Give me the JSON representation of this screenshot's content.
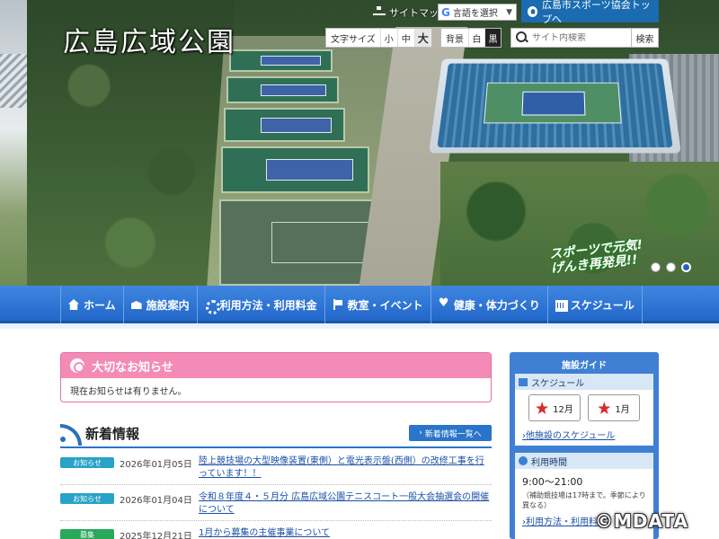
{
  "header": {
    "site_title": "広島広域公園",
    "sitemap_label": "サイトマップ",
    "translate_label": "言語を選択",
    "sports_link": "広島市スポーツ協会トップへ",
    "fontsize": {
      "label": "文字サイズ",
      "small": "小",
      "medium": "中",
      "large": "大"
    },
    "bg": {
      "label": "背景",
      "white": "白",
      "black": "黒"
    },
    "search": {
      "placeholder": "サイト内検索",
      "button": "検索"
    },
    "slogan_line1": "スポーツで元気!",
    "slogan_line2": "げんき再発見!!"
  },
  "nav": {
    "items": [
      {
        "label": "ホーム",
        "icon": "home-icon"
      },
      {
        "label": "施設案内",
        "icon": "facility-icon"
      },
      {
        "label": "利用方法・利用料金",
        "icon": "gear-icon"
      },
      {
        "label": "教室・イベント",
        "icon": "flag-icon"
      },
      {
        "label": "健康・体力づくり",
        "icon": "heart-icon"
      },
      {
        "label": "スケジュール",
        "icon": "calendar-icon"
      }
    ]
  },
  "alert": {
    "title": "大切なお知らせ",
    "body": "現在お知らせは有りません。"
  },
  "news": {
    "title": "新着情報",
    "more": "新着情報一覧へ",
    "items": [
      {
        "tag": "お知らせ",
        "date": "2026年01月05日",
        "text": "陸上競技場の大型映像装置(東側）と電光表示盤(西側）の改修工事を行っています！！"
      },
      {
        "tag": "お知らせ",
        "date": "2026年01月04日",
        "text": "令和８年度４・５月分 広島広域公園テニスコート一般大会抽選会の開催について"
      },
      {
        "tag": "募集",
        "date": "2025年12月21日",
        "text": "1月から募集の主催事業について"
      }
    ]
  },
  "sidebar": {
    "title": "施設ガイド",
    "schedule": {
      "heading": "スケジュール",
      "btn1": "12月",
      "btn2": "1月",
      "link": "他施設のスケジュール"
    },
    "hours": {
      "heading": "利用時間",
      "time": "9:00～21:00",
      "note": "（補助競技場は17時まで。季節により異なる）",
      "link": "利用方法・利用料金"
    }
  },
  "watermark": "©MDATA",
  "colors": {
    "nav_blue": "#2267c9",
    "alert_pink": "#f38bb6",
    "info_tag": "#26a3c6",
    "recruit_tag": "#29a85a"
  }
}
